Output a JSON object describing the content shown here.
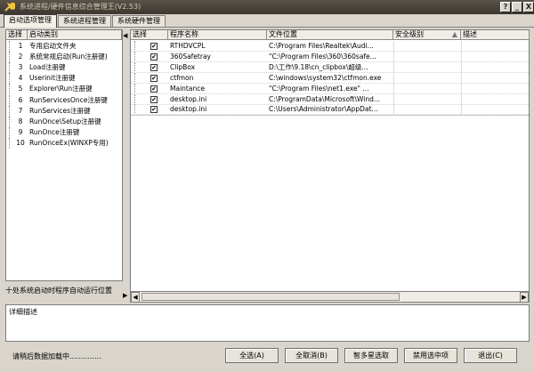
{
  "window": {
    "title": "系统进程/硬件信息综合管理王(V2.53)",
    "buttons": [
      "?",
      "_",
      "X"
    ]
  },
  "tabs": [
    {
      "label": "启动选项管理",
      "active": true
    },
    {
      "label": "系统进程管理",
      "active": false
    },
    {
      "label": "系统硬件管理",
      "active": false
    }
  ],
  "left_panel": {
    "headers": {
      "select": "选择",
      "type": "启动类别"
    },
    "items": [
      {
        "num": "1",
        "label": "专用启动文件夹"
      },
      {
        "num": "2",
        "label": "系统常规启动(Run注册键)"
      },
      {
        "num": "3",
        "label": "Load注册键"
      },
      {
        "num": "4",
        "label": "Userinit注册键"
      },
      {
        "num": "5",
        "label": "Explorer\\Run注册键"
      },
      {
        "num": "6",
        "label": "RunServicesOnce注册键"
      },
      {
        "num": "7",
        "label": "RunServices注册键"
      },
      {
        "num": "8",
        "label": "RunOnce\\Setup注册键"
      },
      {
        "num": "9",
        "label": "RunOnce注册键"
      },
      {
        "num": "10",
        "label": "RunOnceEx(WINXP专用)"
      }
    ],
    "footer": "十处系统启动时程序自动运行位置"
  },
  "right_panel": {
    "headers": {
      "select": "选择",
      "name": "程序名称",
      "path": "文件位置",
      "security": "安全级别",
      "desc": "描述"
    },
    "rows": [
      {
        "name": "RTHDVCPL",
        "path": "C:\\Program Files\\Realtek\\Audi...",
        "checked": true
      },
      {
        "name": "360Safetray",
        "path": "\"C:\\Program Files\\360\\360safe...",
        "checked": true
      },
      {
        "name": "ClipBox",
        "path": "D:\\工作\\9.18\\cn_clipbox\\超级...",
        "checked": true
      },
      {
        "name": "ctfmon",
        "path": "C:\\windows\\system32\\ctfmon.exe",
        "checked": true
      },
      {
        "name": " Maintance",
        "path": "\"C:\\Program Files\\net1.exe\" ...",
        "checked": true
      },
      {
        "name": "desktop.ini",
        "path": "C:\\ProgramData\\Microsoft\\Wind...",
        "checked": true
      },
      {
        "name": "desktop.ini",
        "path": "C:\\Users\\Administrator\\AppDat...",
        "checked": true
      }
    ]
  },
  "detail": {
    "label": "详细描述"
  },
  "status": "请稍后数据加载中..............",
  "actions": {
    "select_all": "全选(A)",
    "deselect_all": "全取消(B)",
    "smart_select": "智多星选取",
    "disable_selected": "禁用选中项",
    "exit": "退出(C)"
  },
  "colors": {
    "titlebar": "#4a453c",
    "window_bg": "#d9d5cd",
    "title_text": "#d2cbb8"
  }
}
